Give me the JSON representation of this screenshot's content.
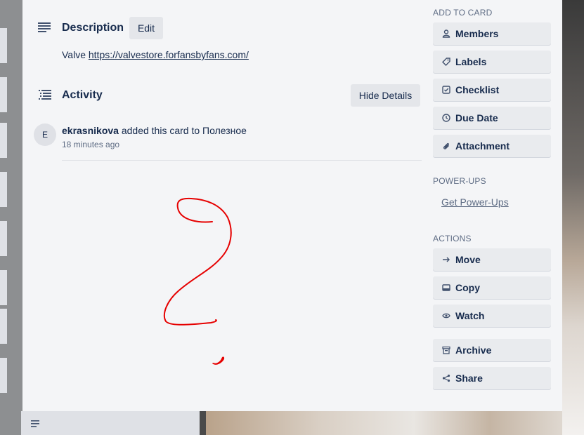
{
  "description": {
    "title": "Description",
    "edit_label": "Edit",
    "text_prefix": "Valve ",
    "link": "https://valvestore.forfansbyfans.com/"
  },
  "activity": {
    "title": "Activity",
    "hide_details_label": "Hide Details",
    "entry": {
      "avatar_initial": "E",
      "user": "ekrasnikova",
      "action": " added this card to Полезное",
      "time": "18 minutes ago"
    }
  },
  "sidebar": {
    "add_to_card_heading": "ADD TO CARD",
    "add_items": [
      {
        "label": "Members",
        "icon": "person-icon"
      },
      {
        "label": "Labels",
        "icon": "tag-icon"
      },
      {
        "label": "Checklist",
        "icon": "checkbox-icon"
      },
      {
        "label": "Due Date",
        "icon": "clock-icon"
      },
      {
        "label": "Attachment",
        "icon": "paperclip-icon"
      }
    ],
    "power_ups_heading": "POWER-UPS",
    "get_power_ups_label": "Get Power-Ups",
    "actions_heading": "ACTIONS",
    "action_items": [
      {
        "label": "Move",
        "icon": "arrow-right-icon"
      },
      {
        "label": "Copy",
        "icon": "copy-icon"
      },
      {
        "label": "Watch",
        "icon": "eye-icon"
      },
      {
        "label": "Archive",
        "icon": "archive-icon"
      },
      {
        "label": "Share",
        "icon": "share-icon"
      }
    ]
  },
  "colors": {
    "modal_bg": "#f4f5f7",
    "text": "#172b4d",
    "muted": "#5e6c84",
    "annotation_red": "#e60000"
  }
}
